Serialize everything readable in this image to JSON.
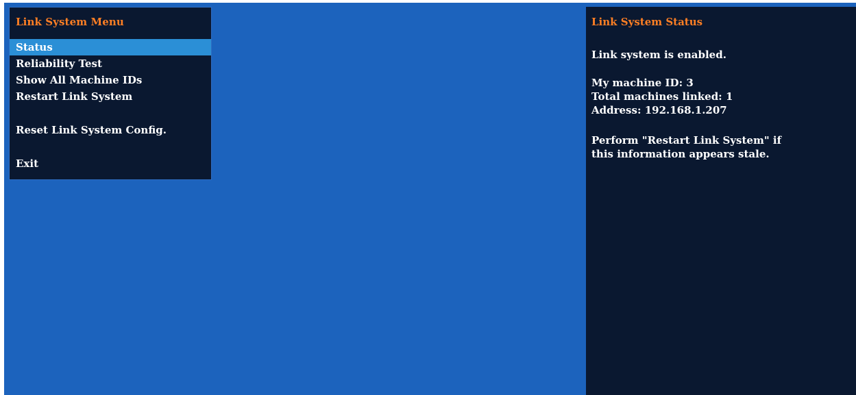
{
  "menu": {
    "title": "Link System Menu",
    "items": [
      {
        "label": "Status",
        "selected": true
      },
      {
        "label": "Reliability Test",
        "selected": false
      },
      {
        "label": "Show All Machine IDs",
        "selected": false
      },
      {
        "label": "Restart Link System",
        "selected": false
      },
      {
        "label": "Reset Link System Config.",
        "selected": false
      },
      {
        "label": "Exit",
        "selected": false
      }
    ]
  },
  "status": {
    "title": "Link System Status",
    "enabled_text": "Link system is enabled.",
    "machine_id_text": "My machine ID: 3",
    "total_linked_text": "Total machines linked: 1",
    "address_text": "Address: 192.168.1.207",
    "hint_line1": "Perform \"Restart Link System\" if",
    "hint_line2": "this information appears stale."
  },
  "colors": {
    "background": "#1c63bd",
    "panel": "#0a1830",
    "title": "#ff7f24",
    "highlight": "#2b8fd6",
    "text": "#ffffff"
  }
}
